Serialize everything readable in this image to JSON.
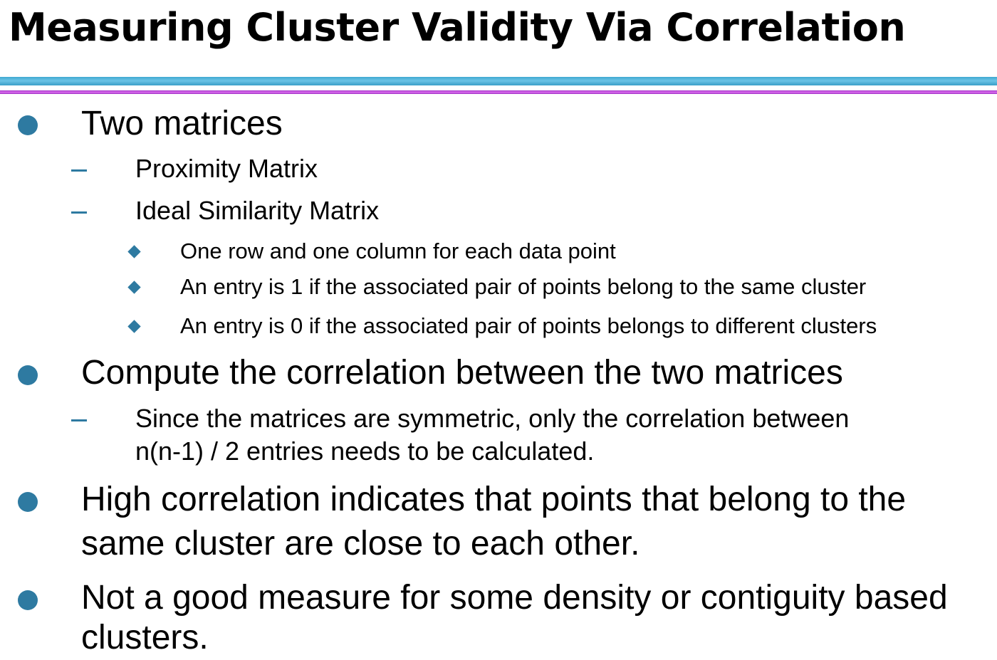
{
  "slide": {
    "title": "Measuring  Cluster  Validity  Via  Correlation",
    "bullets": [
      {
        "text": "Two matrices",
        "sub": [
          {
            "text": "Proximity Matrix"
          },
          {
            "text": "Ideal Similarity Matrix",
            "sub": [
              {
                "text": "One  row  and  one  column  for each  data  point"
              },
              {
                "text": "An  entry  is 1  if the associated  pair of points  belong  to the same cluster"
              },
              {
                "text": "An  entry  is 0  if the associated  pair of points  belongs  to different  clusters"
              }
            ]
          }
        ]
      },
      {
        "text": "Compute the correlation between the two matrices",
        "sub": [
          {
            "text_line1": "Since the matrices are symmetric, only the correlation between",
            "text_line2": "n(n-1) / 2 entries needs to be calculated."
          }
        ]
      },
      {
        "text_line1": "High correlation indicates that points that belong to the",
        "text_line2": "same cluster are close to each other."
      },
      {
        "text_line1": "Not a good measure for some density or contiguity based",
        "text_line2": "clusters."
      }
    ]
  },
  "icons": {
    "level1": "circle-bullet-icon",
    "level2": "dash-bullet-icon",
    "level3": "diamond-bullet-icon"
  },
  "colors": {
    "bullet": "#2e7aa1",
    "rule_blue": "#3fa8d1",
    "rule_purple": "#c04ee0",
    "text": "#000000"
  }
}
